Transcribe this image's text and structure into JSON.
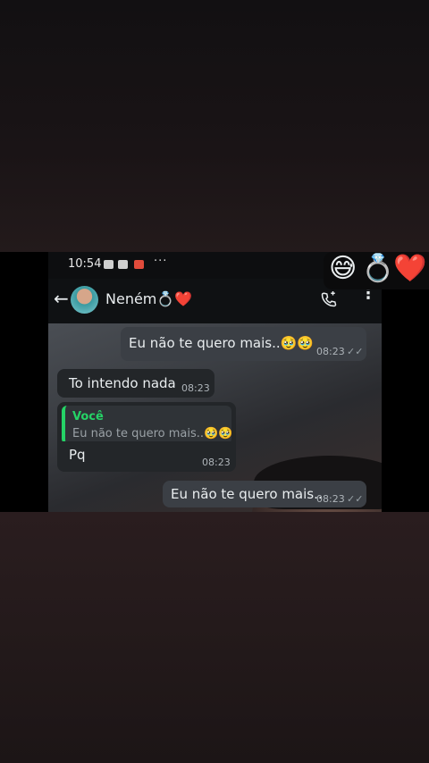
{
  "status_bar": {
    "time": "10:54",
    "more": "···"
  },
  "header": {
    "back": "←",
    "contact_name": "Neném💍❤️",
    "menu": "⋮"
  },
  "messages": [
    {
      "text": "Eu não te quero mais..🥹🥹",
      "time": "08:23",
      "ticks": "✓✓"
    },
    {
      "text": "To intendo nada",
      "time": "08:23"
    },
    {
      "quote_author": "Você",
      "quote_text": "Eu não te quero mais..🥹🥹",
      "text": "Pq",
      "time": "08:23"
    },
    {
      "text": "Eu não te quero mais..",
      "time": "08:23",
      "ticks": "✓✓"
    }
  ],
  "sticker": {
    "e1": "😅",
    "e2": "💍",
    "e3": "❤️"
  }
}
